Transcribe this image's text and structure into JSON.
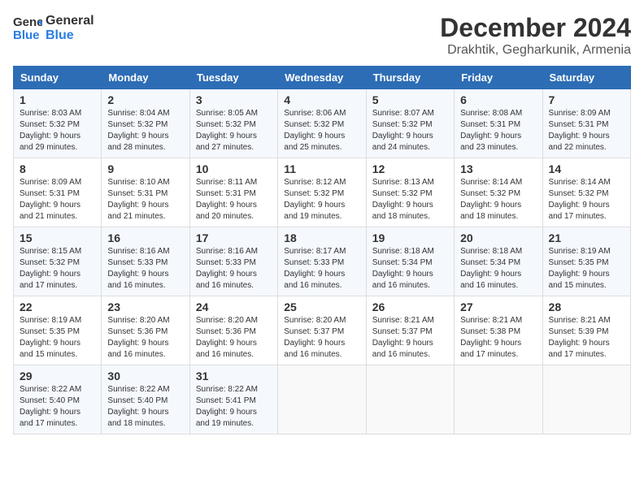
{
  "logo": {
    "general": "General",
    "blue": "Blue"
  },
  "title": "December 2024",
  "location": "Drakhtik, Gegharkunik, Armenia",
  "days_header": [
    "Sunday",
    "Monday",
    "Tuesday",
    "Wednesday",
    "Thursday",
    "Friday",
    "Saturday"
  ],
  "weeks": [
    [
      {
        "day": "1",
        "sunrise": "Sunrise: 8:03 AM",
        "sunset": "Sunset: 5:32 PM",
        "daylight": "Daylight: 9 hours and 29 minutes."
      },
      {
        "day": "2",
        "sunrise": "Sunrise: 8:04 AM",
        "sunset": "Sunset: 5:32 PM",
        "daylight": "Daylight: 9 hours and 28 minutes."
      },
      {
        "day": "3",
        "sunrise": "Sunrise: 8:05 AM",
        "sunset": "Sunset: 5:32 PM",
        "daylight": "Daylight: 9 hours and 27 minutes."
      },
      {
        "day": "4",
        "sunrise": "Sunrise: 8:06 AM",
        "sunset": "Sunset: 5:32 PM",
        "daylight": "Daylight: 9 hours and 25 minutes."
      },
      {
        "day": "5",
        "sunrise": "Sunrise: 8:07 AM",
        "sunset": "Sunset: 5:32 PM",
        "daylight": "Daylight: 9 hours and 24 minutes."
      },
      {
        "day": "6",
        "sunrise": "Sunrise: 8:08 AM",
        "sunset": "Sunset: 5:31 PM",
        "daylight": "Daylight: 9 hours and 23 minutes."
      },
      {
        "day": "7",
        "sunrise": "Sunrise: 8:09 AM",
        "sunset": "Sunset: 5:31 PM",
        "daylight": "Daylight: 9 hours and 22 minutes."
      }
    ],
    [
      {
        "day": "8",
        "sunrise": "Sunrise: 8:09 AM",
        "sunset": "Sunset: 5:31 PM",
        "daylight": "Daylight: 9 hours and 21 minutes."
      },
      {
        "day": "9",
        "sunrise": "Sunrise: 8:10 AM",
        "sunset": "Sunset: 5:31 PM",
        "daylight": "Daylight: 9 hours and 21 minutes."
      },
      {
        "day": "10",
        "sunrise": "Sunrise: 8:11 AM",
        "sunset": "Sunset: 5:31 PM",
        "daylight": "Daylight: 9 hours and 20 minutes."
      },
      {
        "day": "11",
        "sunrise": "Sunrise: 8:12 AM",
        "sunset": "Sunset: 5:32 PM",
        "daylight": "Daylight: 9 hours and 19 minutes."
      },
      {
        "day": "12",
        "sunrise": "Sunrise: 8:13 AM",
        "sunset": "Sunset: 5:32 PM",
        "daylight": "Daylight: 9 hours and 18 minutes."
      },
      {
        "day": "13",
        "sunrise": "Sunrise: 8:14 AM",
        "sunset": "Sunset: 5:32 PM",
        "daylight": "Daylight: 9 hours and 18 minutes."
      },
      {
        "day": "14",
        "sunrise": "Sunrise: 8:14 AM",
        "sunset": "Sunset: 5:32 PM",
        "daylight": "Daylight: 9 hours and 17 minutes."
      }
    ],
    [
      {
        "day": "15",
        "sunrise": "Sunrise: 8:15 AM",
        "sunset": "Sunset: 5:32 PM",
        "daylight": "Daylight: 9 hours and 17 minutes."
      },
      {
        "day": "16",
        "sunrise": "Sunrise: 8:16 AM",
        "sunset": "Sunset: 5:33 PM",
        "daylight": "Daylight: 9 hours and 16 minutes."
      },
      {
        "day": "17",
        "sunrise": "Sunrise: 8:16 AM",
        "sunset": "Sunset: 5:33 PM",
        "daylight": "Daylight: 9 hours and 16 minutes."
      },
      {
        "day": "18",
        "sunrise": "Sunrise: 8:17 AM",
        "sunset": "Sunset: 5:33 PM",
        "daylight": "Daylight: 9 hours and 16 minutes."
      },
      {
        "day": "19",
        "sunrise": "Sunrise: 8:18 AM",
        "sunset": "Sunset: 5:34 PM",
        "daylight": "Daylight: 9 hours and 16 minutes."
      },
      {
        "day": "20",
        "sunrise": "Sunrise: 8:18 AM",
        "sunset": "Sunset: 5:34 PM",
        "daylight": "Daylight: 9 hours and 16 minutes."
      },
      {
        "day": "21",
        "sunrise": "Sunrise: 8:19 AM",
        "sunset": "Sunset: 5:35 PM",
        "daylight": "Daylight: 9 hours and 15 minutes."
      }
    ],
    [
      {
        "day": "22",
        "sunrise": "Sunrise: 8:19 AM",
        "sunset": "Sunset: 5:35 PM",
        "daylight": "Daylight: 9 hours and 15 minutes."
      },
      {
        "day": "23",
        "sunrise": "Sunrise: 8:20 AM",
        "sunset": "Sunset: 5:36 PM",
        "daylight": "Daylight: 9 hours and 16 minutes."
      },
      {
        "day": "24",
        "sunrise": "Sunrise: 8:20 AM",
        "sunset": "Sunset: 5:36 PM",
        "daylight": "Daylight: 9 hours and 16 minutes."
      },
      {
        "day": "25",
        "sunrise": "Sunrise: 8:20 AM",
        "sunset": "Sunset: 5:37 PM",
        "daylight": "Daylight: 9 hours and 16 minutes."
      },
      {
        "day": "26",
        "sunrise": "Sunrise: 8:21 AM",
        "sunset": "Sunset: 5:37 PM",
        "daylight": "Daylight: 9 hours and 16 minutes."
      },
      {
        "day": "27",
        "sunrise": "Sunrise: 8:21 AM",
        "sunset": "Sunset: 5:38 PM",
        "daylight": "Daylight: 9 hours and 17 minutes."
      },
      {
        "day": "28",
        "sunrise": "Sunrise: 8:21 AM",
        "sunset": "Sunset: 5:39 PM",
        "daylight": "Daylight: 9 hours and 17 minutes."
      }
    ],
    [
      {
        "day": "29",
        "sunrise": "Sunrise: 8:22 AM",
        "sunset": "Sunset: 5:40 PM",
        "daylight": "Daylight: 9 hours and 17 minutes."
      },
      {
        "day": "30",
        "sunrise": "Sunrise: 8:22 AM",
        "sunset": "Sunset: 5:40 PM",
        "daylight": "Daylight: 9 hours and 18 minutes."
      },
      {
        "day": "31",
        "sunrise": "Sunrise: 8:22 AM",
        "sunset": "Sunset: 5:41 PM",
        "daylight": "Daylight: 9 hours and 19 minutes."
      },
      null,
      null,
      null,
      null
    ]
  ]
}
